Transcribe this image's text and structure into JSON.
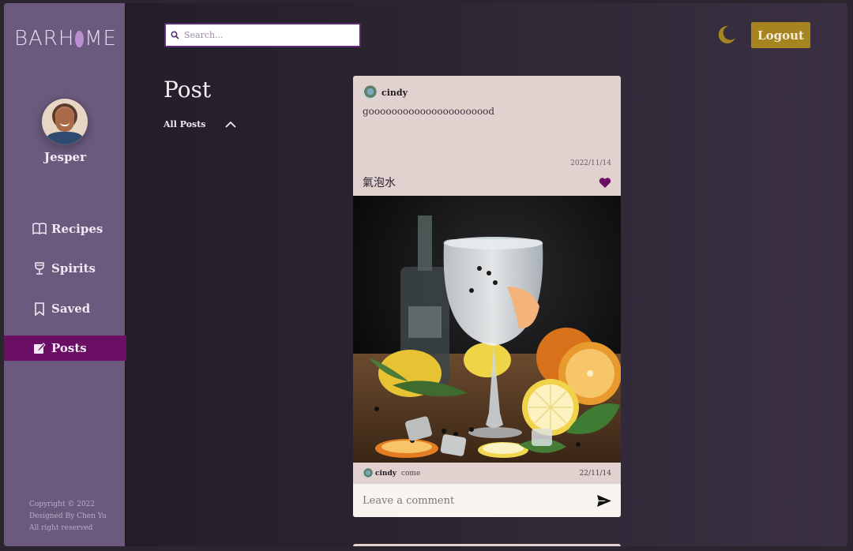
{
  "brand": {
    "logo_prefix": "BARH",
    "logo_suffix": "ME"
  },
  "user": {
    "name": "Jesper"
  },
  "sidebar": {
    "items": [
      {
        "label": "Recipes",
        "icon": "book-open-icon"
      },
      {
        "label": "Spirits",
        "icon": "wine-glass-icon"
      },
      {
        "label": "Saved",
        "icon": "bookmark-icon"
      },
      {
        "label": "Posts",
        "icon": "edit-icon",
        "active": true
      }
    ],
    "copyright": [
      "Copyright © 2022",
      "Designed By Chen Yu",
      "All right reserved"
    ]
  },
  "header": {
    "search_placeholder": "Search...",
    "logout_label": "Logout",
    "theme_icon": "moon-icon"
  },
  "main": {
    "title": "Post",
    "filter_label": "All Posts"
  },
  "post": {
    "author": "cindy",
    "text": "goooooooooooooooooooood",
    "date": "2022/11/14",
    "drink": "氣泡水",
    "liked": true,
    "comment": {
      "author": "cindy",
      "text": "come",
      "date": "22/11/14"
    },
    "comment_placeholder": "Leave a comment"
  },
  "colors": {
    "sidebar": "#6b5a7d",
    "active": "#6a0f64",
    "accent": "#a68420",
    "heart": "#6a0f64"
  }
}
